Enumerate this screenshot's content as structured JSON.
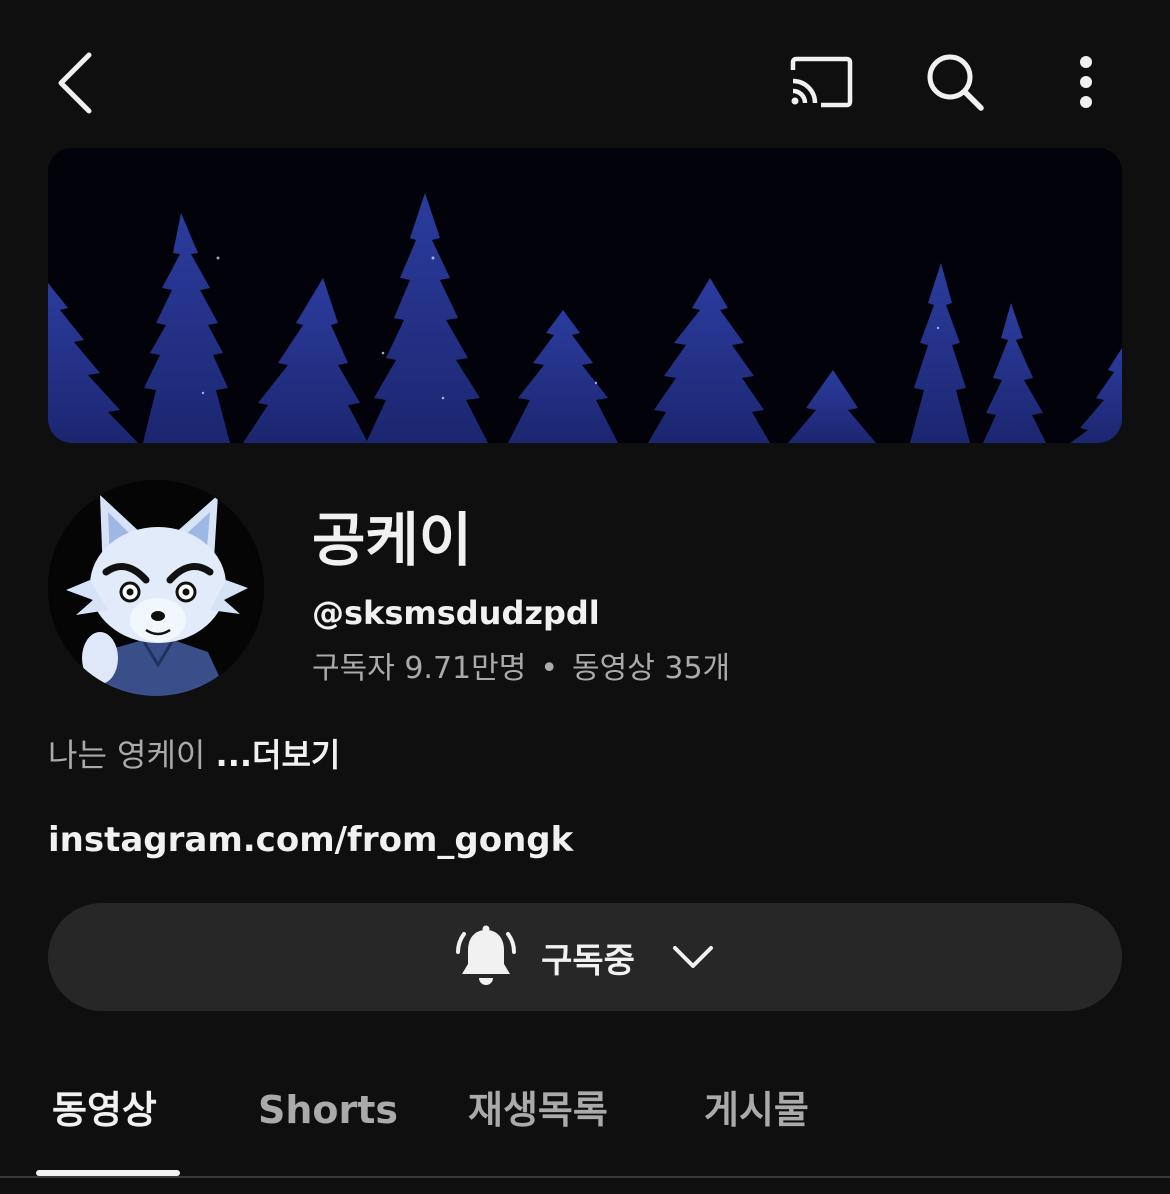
{
  "topbar": {
    "back_icon": "chevron-left-icon",
    "cast_icon": "cast-icon",
    "search_icon": "search-icon",
    "more_icon": "more-vertical-icon"
  },
  "channel": {
    "name": "공케이",
    "handle": "@sksmsdudzpdl",
    "subscribers": "구독자 9.71만명",
    "separator": "•",
    "videos": "동영상 35개",
    "description": "나는 영케이 ",
    "more_label": "...더보기",
    "link": "instagram.com/from_gongk"
  },
  "subscribe": {
    "label": "구독중",
    "bell_icon": "bell-ringing-icon",
    "chevron_icon": "chevron-down-icon"
  },
  "tabs": [
    {
      "label": "동영상",
      "active": true
    },
    {
      "label": "Shorts",
      "active": false
    },
    {
      "label": "재생목록",
      "active": false
    },
    {
      "label": "게시물",
      "active": false
    }
  ],
  "colors": {
    "background": "#0f0f0f",
    "surface": "#272727",
    "text_primary": "#f1f1f1",
    "text_secondary": "#aaaaaa",
    "banner_trees": "#2a3aa0"
  }
}
